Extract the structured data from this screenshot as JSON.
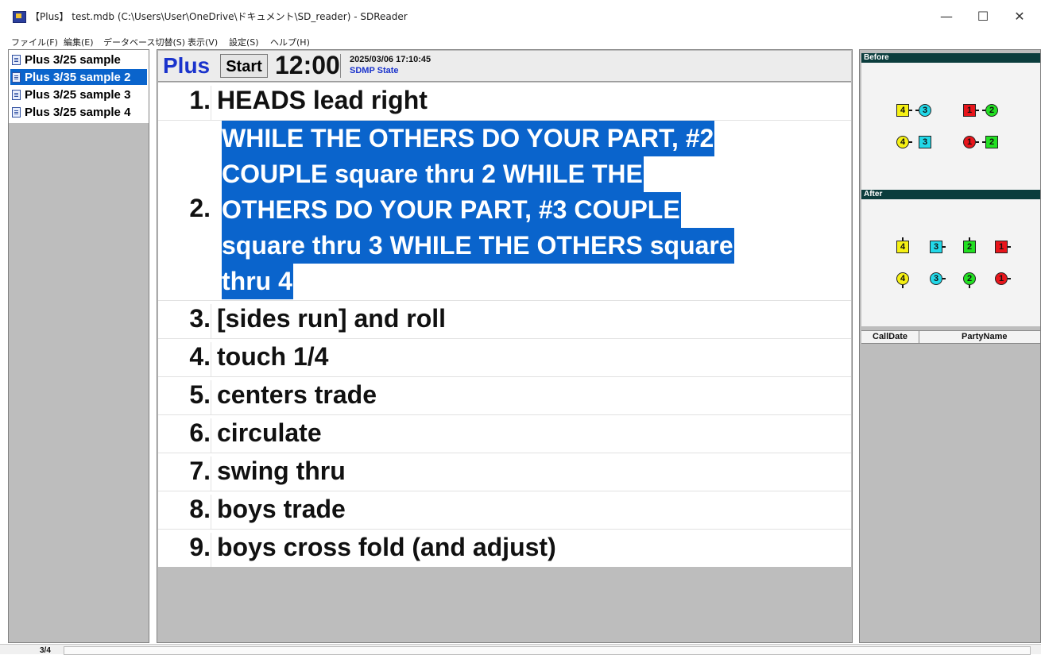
{
  "window": {
    "title": "【Plus】 test.mdb (C:\\Users\\User\\OneDrive\\ドキュメント\\SD_reader) - SDReader",
    "minimize": "—",
    "maximize": "☐",
    "close": "✕"
  },
  "menu": [
    "ファイル(F)",
    "編集(E)",
    "データベース切替(S)",
    "表示(V)",
    "設定(S)",
    "ヘルプ(H)"
  ],
  "sequences": [
    {
      "label": "Plus 3/25 sample",
      "selected": false
    },
    {
      "label": "Plus 3/35 sample 2",
      "selected": true
    },
    {
      "label": "Plus 3/25 sample 3",
      "selected": false
    },
    {
      "label": "Plus 3/25 sample 4",
      "selected": false
    }
  ],
  "header": {
    "level": "Plus",
    "start_label": "Start",
    "timer": "12:00",
    "datetime": "2025/03/06 17:10:45",
    "state": "SDMP State"
  },
  "calls": [
    {
      "num": "1.",
      "text": "HEADS lead right"
    },
    {
      "num": "2.",
      "lines": [
        "WHILE THE OTHERS DO YOUR PART, #2",
        "COUPLE square thru 2 WHILE THE",
        "OTHERS DO YOUR PART, #3 COUPLE",
        "square thru 3 WHILE THE OTHERS square",
        "thru 4"
      ],
      "highlighted": true
    },
    {
      "num": "3.",
      "text": "[sides run] and roll"
    },
    {
      "num": "4.",
      "text": "touch 1/4"
    },
    {
      "num": "5.",
      "text": "centers trade"
    },
    {
      "num": "6.",
      "text": "circulate"
    },
    {
      "num": "7.",
      "text": "swing thru"
    },
    {
      "num": "8.",
      "text": "boys trade"
    },
    {
      "num": "9.",
      "text": "boys cross fold (and adjust)"
    }
  ],
  "formations": {
    "before_label": "Before",
    "after_label": "After"
  },
  "history_columns": [
    "CallDate",
    "PartyName"
  ],
  "status": {
    "page": "3/4"
  },
  "colors": {
    "couple1": "#e8151b",
    "couple2": "#22e022",
    "couple3": "#22d8e8",
    "couple4": "#f5f014",
    "selection": "#0a64cc",
    "panel_label": "#0b3d3d"
  }
}
